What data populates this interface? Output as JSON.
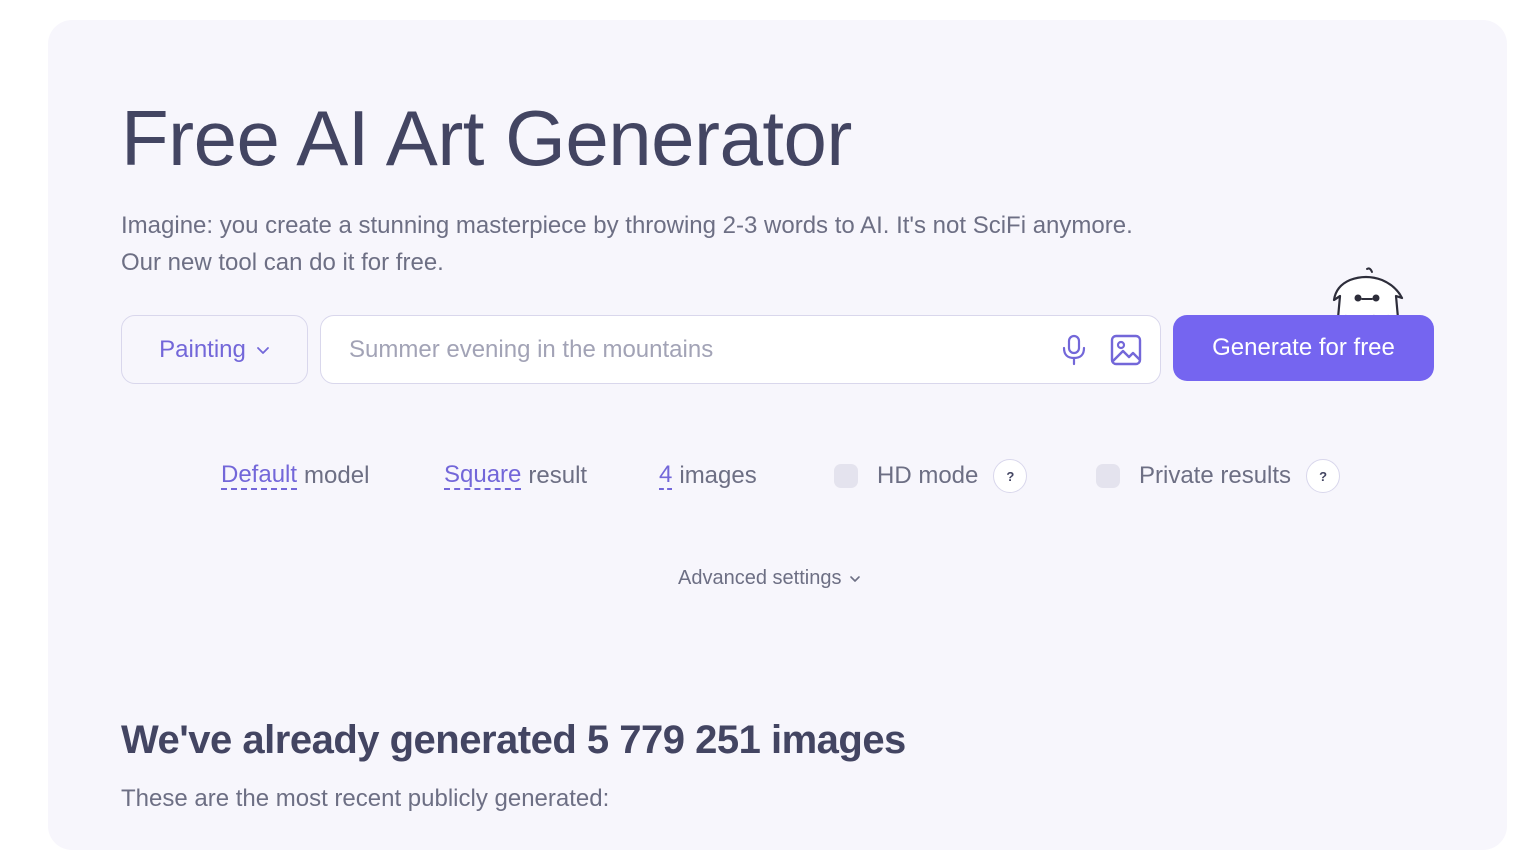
{
  "hero": {
    "title": "Free AI Art Generator",
    "subtitle_line1": "Imagine: you create a stunning masterpiece by throwing 2-3 words to AI. It's not SciFi anymore.",
    "subtitle_line2": "Our new tool can do it for free."
  },
  "prompt": {
    "style": "Painting",
    "placeholder": "Summer evening in the mountains",
    "value": "",
    "generate_label": "Generate for free"
  },
  "options": {
    "model_value": "Default",
    "model_suffix": "model",
    "aspect_value": "Square",
    "aspect_suffix": "result",
    "count_value": "4",
    "count_suffix": "images",
    "hd_label": "HD mode",
    "hd_checked": false,
    "private_label": "Private results",
    "private_checked": false,
    "help_symbol": "?"
  },
  "advanced_label": "Advanced settings",
  "stats": {
    "heading": "We've already generated 5 779 251 images",
    "subheading": "These are the most recent publicly generated:"
  },
  "colors": {
    "accent": "#7565f0",
    "link": "#7367d9",
    "heading": "#434562",
    "text": "#6d6f84",
    "card_bg": "#f7f6fc"
  },
  "icons": {
    "style_chevron": "chevron-down-icon",
    "microphone": "microphone-icon",
    "image_upload": "image-icon",
    "mascot": "mascot-icon",
    "advanced_chevron": "chevron-down-icon"
  }
}
